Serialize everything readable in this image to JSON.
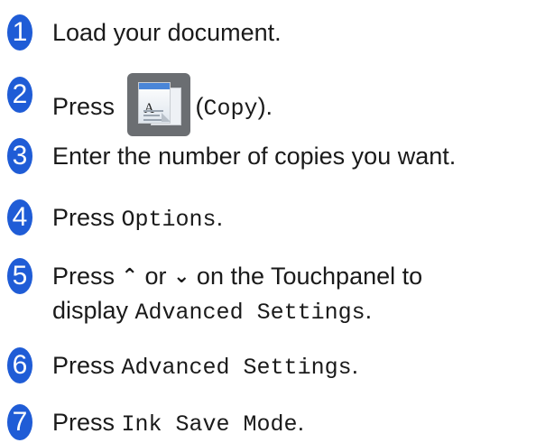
{
  "steps": [
    {
      "num": "1",
      "text": "Load your document."
    },
    {
      "num": "2",
      "prefix": "Press",
      "button_label": "Copy",
      "paren_open": "(",
      "paren_close": ").",
      "icon": "copy-icon"
    },
    {
      "num": "3",
      "text": "Enter the number of copies you want."
    },
    {
      "num": "4",
      "prefix": "Press ",
      "code": "Options",
      "suffix": "."
    },
    {
      "num": "5",
      "line1_prefix": "Press ",
      "up_glyph": "⌃",
      "mid": " or ",
      "down_glyph": "⌄",
      "line1_suffix": " on the Touchpanel to",
      "line2_prefix": "display ",
      "code": "Advanced Settings",
      "suffix": "."
    },
    {
      "num": "6",
      "prefix": "Press ",
      "code": "Advanced Settings",
      "suffix": "."
    },
    {
      "num": "7",
      "prefix": "Press ",
      "code": "Ink Save Mode",
      "suffix": "."
    }
  ],
  "colors": {
    "badge": "#1f5cd6",
    "text": "#1a1a1a",
    "copy_button_bg": "#6b6e72"
  }
}
